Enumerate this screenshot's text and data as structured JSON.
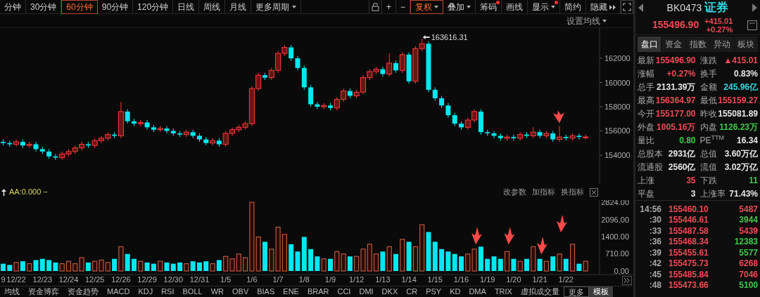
{
  "period_tabs": [
    {
      "label": "分钟",
      "selected": false
    },
    {
      "label": "30分钟",
      "selected": false
    },
    {
      "label": "60分钟",
      "selected": true
    },
    {
      "label": "90分钟",
      "selected": false
    },
    {
      "label": "120分钟",
      "selected": false
    },
    {
      "label": "日线",
      "selected": false
    },
    {
      "label": "周线",
      "selected": false
    },
    {
      "label": "月线",
      "selected": false
    }
  ],
  "more_periods": "更多周期",
  "tools": [
    {
      "kind": "lock"
    },
    {
      "kind": "text",
      "label": "+",
      "caret": false,
      "dot": false,
      "highlighted": false,
      "arrows": false
    },
    {
      "kind": "text",
      "label": "−",
      "caret": false,
      "dot": false,
      "highlighted": false,
      "arrows": false
    },
    {
      "kind": "text",
      "label": "复权",
      "caret": true,
      "dot": false,
      "highlighted": true,
      "arrows": false
    },
    {
      "kind": "text",
      "label": "叠加",
      "caret": true,
      "dot": false,
      "highlighted": false,
      "arrows": false
    },
    {
      "kind": "text",
      "label": "筹码",
      "caret": false,
      "dot": true,
      "highlighted": false,
      "arrows": false
    },
    {
      "kind": "text",
      "label": "画线",
      "caret": false,
      "dot": false,
      "highlighted": false,
      "arrows": false
    },
    {
      "kind": "text",
      "label": "显示",
      "caret": true,
      "dot": true,
      "highlighted": false,
      "arrows": false
    },
    {
      "kind": "text",
      "label": "简约",
      "caret": false,
      "dot": false,
      "highlighted": false,
      "arrows": false
    },
    {
      "kind": "text",
      "label": "隐藏",
      "caret": false,
      "dot": false,
      "highlighted": false,
      "arrows": true
    },
    {
      "kind": "expand"
    }
  ],
  "ma_settings": "设置均线",
  "price_chart": {
    "chart_data": {
      "type": "candlestick",
      "categories": [
        null,
        null,
        null,
        null,
        null,
        null,
        null,
        null,
        null,
        null,
        null,
        null,
        null,
        null,
        null,
        null,
        null,
        null,
        null,
        null,
        null,
        null,
        null,
        null,
        null,
        null,
        null,
        null,
        null,
        null,
        null,
        null,
        null,
        null,
        null,
        null,
        null,
        null,
        null,
        null,
        null,
        null,
        null,
        null,
        null,
        null,
        null,
        null,
        null,
        null,
        null,
        null,
        null,
        null,
        null,
        null,
        null,
        null,
        null,
        null,
        null,
        null,
        null,
        null,
        null,
        null,
        null,
        null,
        null,
        null,
        null,
        null,
        null,
        null,
        null,
        null,
        null,
        null,
        null,
        null,
        null,
        null,
        null,
        null,
        null,
        null,
        null,
        null,
        null,
        null
      ],
      "ylim": [
        151623,
        164493
      ],
      "yticks": [
        {
          "value": 154000,
          "label": "154000"
        },
        {
          "value": 156000,
          "label": "156000"
        },
        {
          "value": 158000,
          "label": "158000"
        },
        {
          "value": 160000,
          "label": "160000"
        },
        {
          "value": 162000,
          "label": "162000"
        }
      ],
      "ohlc": [
        [
          155100,
          155300,
          154800,
          155000
        ],
        [
          155000,
          155200,
          154700,
          154900
        ],
        [
          154900,
          155300,
          154700,
          155100
        ],
        [
          155100,
          155300,
          154600,
          154800
        ],
        [
          154800,
          155100,
          154600,
          154900
        ],
        [
          154900,
          155100,
          154300,
          154500
        ],
        [
          154500,
          154700,
          154100,
          154300
        ],
        [
          154300,
          154500,
          153700,
          153900
        ],
        [
          153900,
          154100,
          153600,
          153800
        ],
        [
          153800,
          154300,
          153600,
          154100
        ],
        [
          154100,
          154500,
          153900,
          154300
        ],
        [
          154300,
          154800,
          154100,
          154600
        ],
        [
          154600,
          155100,
          154400,
          154900
        ],
        [
          154900,
          155100,
          154600,
          154800
        ],
        [
          154800,
          155400,
          154600,
          155200
        ],
        [
          155200,
          155600,
          155000,
          155400
        ],
        [
          155400,
          155900,
          155200,
          155700
        ],
        [
          155700,
          155900,
          155400,
          155600
        ],
        [
          155600,
          158400,
          155400,
          157600
        ],
        [
          157600,
          157800,
          156600,
          156800
        ],
        [
          156800,
          157000,
          156400,
          156600
        ],
        [
          156600,
          156900,
          156400,
          156700
        ],
        [
          156700,
          156900,
          156100,
          156300
        ],
        [
          156300,
          156500,
          155900,
          156100
        ],
        [
          156100,
          156400,
          155900,
          156200
        ],
        [
          156200,
          156400,
          155800,
          156000
        ],
        [
          156000,
          156200,
          155600,
          155800
        ],
        [
          155800,
          156000,
          155500,
          155700
        ],
        [
          155700,
          156100,
          155500,
          155900
        ],
        [
          155900,
          156100,
          155400,
          155600
        ],
        [
          155600,
          155800,
          155100,
          155300
        ],
        [
          155300,
          155500,
          154800,
          155000
        ],
        [
          155000,
          155400,
          154800,
          155200
        ],
        [
          155200,
          155400,
          154700,
          154900
        ],
        [
          154900,
          156000,
          154700,
          155800
        ],
        [
          155800,
          156300,
          155600,
          156100
        ],
        [
          156100,
          156500,
          155900,
          156300
        ],
        [
          156300,
          156800,
          156100,
          156600
        ],
        [
          156600,
          159700,
          156400,
          159500
        ],
        [
          159500,
          160800,
          159300,
          160600
        ],
        [
          160600,
          160800,
          160200,
          160400
        ],
        [
          160400,
          161200,
          160200,
          161000
        ],
        [
          161000,
          162600,
          160800,
          162400
        ],
        [
          162400,
          163100,
          162200,
          162900
        ],
        [
          162900,
          163100,
          161800,
          162000
        ],
        [
          162000,
          162200,
          161000,
          161200
        ],
        [
          161200,
          161400,
          159400,
          159600
        ],
        [
          159600,
          159800,
          158000,
          158200
        ],
        [
          158200,
          158400,
          157800,
          158000
        ],
        [
          158000,
          158300,
          157800,
          158100
        ],
        [
          158100,
          158300,
          157700,
          157900
        ],
        [
          157900,
          158800,
          157700,
          158600
        ],
        [
          158600,
          159500,
          158400,
          159300
        ],
        [
          159300,
          159500,
          158700,
          158900
        ],
        [
          158900,
          159400,
          158700,
          159200
        ],
        [
          159200,
          160600,
          159000,
          160400
        ],
        [
          160400,
          161100,
          160200,
          160900
        ],
        [
          160900,
          161300,
          160700,
          161100
        ],
        [
          161100,
          161300,
          160500,
          160700
        ],
        [
          160700,
          162400,
          160500,
          161600
        ],
        [
          161600,
          161800,
          160800,
          161000
        ],
        [
          161000,
          162500,
          160800,
          162300
        ],
        [
          162300,
          162500,
          159900,
          160100
        ],
        [
          160100,
          163000,
          159900,
          162800
        ],
        [
          162800,
          163616.31,
          162600,
          163200
        ],
        [
          163200,
          163400,
          159200,
          159400
        ],
        [
          159400,
          159600,
          158500,
          158700
        ],
        [
          158700,
          158900,
          157900,
          158100
        ],
        [
          158100,
          158300,
          157100,
          157300
        ],
        [
          157300,
          157500,
          156400,
          156600
        ],
        [
          156600,
          156800,
          156100,
          156300
        ],
        [
          156300,
          157100,
          156100,
          156900
        ],
        [
          156900,
          157800,
          156700,
          157600
        ],
        [
          157600,
          157800,
          155700,
          155900
        ],
        [
          155900,
          156100,
          155600,
          155800
        ],
        [
          155800,
          156000,
          155400,
          155600
        ],
        [
          155600,
          155800,
          155200,
          155400
        ],
        [
          155400,
          155700,
          155200,
          155500
        ],
        [
          155500,
          155700,
          155200,
          155400
        ],
        [
          155400,
          155900,
          155200,
          155700
        ],
        [
          155700,
          155900,
          155400,
          155600
        ],
        [
          155600,
          156300,
          155400,
          155900
        ],
        [
          155900,
          156100,
          155400,
          155600
        ],
        [
          155600,
          156000,
          155400,
          155800
        ],
        [
          155800,
          156000,
          155100,
          155300
        ],
        [
          155300,
          156400,
          155100,
          155500
        ],
        [
          155500,
          155700,
          155200,
          155400
        ],
        [
          155400,
          155800,
          155200,
          155600
        ],
        [
          155600,
          155800,
          155300,
          155500
        ],
        [
          155500,
          155700,
          155300,
          155500
        ]
      ],
      "annotations": [
        {
          "text": "163616.31"
        }
      ]
    }
  },
  "indicator_header": {
    "label": "AA:0.000 −",
    "actions": [
      "改参数",
      "加指标",
      "换指标"
    ]
  },
  "volume_chart": {
    "chart_data": {
      "type": "bar",
      "categories": [
        "9",
        null,
        "12/22",
        null,
        null,
        null,
        "12/23",
        null,
        null,
        null,
        "12/24",
        null,
        null,
        null,
        "12/25",
        null,
        null,
        null,
        "12/26",
        null,
        null,
        null,
        "12/29",
        null,
        null,
        null,
        "12/30",
        null,
        null,
        null,
        "12/31",
        null,
        null,
        null,
        "1/5",
        null,
        null,
        null,
        "1/6",
        null,
        null,
        null,
        "1/7",
        null,
        null,
        null,
        "1/8",
        null,
        null,
        null,
        "1/9",
        null,
        null,
        null,
        "1/12",
        null,
        null,
        null,
        "1/13",
        null,
        null,
        null,
        "1/14",
        null,
        null,
        null,
        "1/15",
        null,
        null,
        null,
        "1/16",
        null,
        null,
        null,
        "1/19",
        null,
        null,
        null,
        "1/20",
        null,
        null,
        null,
        "1/21",
        null,
        null,
        null,
        "1/22",
        null,
        null,
        null
      ],
      "ylim": [
        0,
        2910
      ],
      "values": [
        300,
        250,
        350,
        400,
        300,
        450,
        500,
        450,
        350,
        300,
        400,
        300,
        550,
        350,
        400,
        450,
        350,
        500,
        1000,
        700,
        500,
        400,
        350,
        300,
        400,
        350,
        300,
        350,
        300,
        400,
        350,
        400,
        300,
        450,
        600,
        500,
        700,
        550,
        2824,
        1400,
        1200,
        900,
        1800,
        1500,
        1100,
        800,
        1400,
        900,
        600,
        500,
        500,
        800,
        700,
        600,
        600,
        900,
        1100,
        700,
        800,
        1000,
        700,
        1300,
        1200,
        1000,
        1900,
        1600,
        1200,
        900,
        800,
        700,
        600,
        700,
        900,
        1000,
        500,
        600,
        500,
        800,
        500,
        400,
        500,
        1000,
        500,
        400,
        600,
        700,
        500,
        1100,
        300,
        400
      ],
      "yticks": [
        {
          "value": 0,
          "label": "0.00"
        },
        {
          "value": 710,
          "label": "710.00"
        },
        {
          "value": 1400,
          "label": "1400.00"
        },
        {
          "value": 2096,
          "label": "2096.00"
        },
        {
          "value": 2824,
          "label": "2824.00"
        }
      ]
    }
  },
  "indicator_tabs": [
    {
      "label": "均线",
      "kind": "tab",
      "selected": false
    },
    {
      "label": "资金博弈",
      "kind": "tab",
      "selected": false
    },
    {
      "label": "资金趋势",
      "kind": "tab",
      "selected": false
    },
    {
      "label": "MACD",
      "kind": "tab",
      "selected": false
    },
    {
      "label": "KDJ",
      "kind": "tab",
      "selected": false
    },
    {
      "label": "RSI",
      "kind": "tab",
      "selected": false
    },
    {
      "label": "BOLL",
      "kind": "tab",
      "selected": false
    },
    {
      "label": "WR",
      "kind": "tab",
      "selected": false
    },
    {
      "label": "OBV",
      "kind": "tab",
      "selected": false
    },
    {
      "label": "BIAS",
      "kind": "tab",
      "selected": false
    },
    {
      "label": "ENE",
      "kind": "tab",
      "selected": false
    },
    {
      "label": "BRAR",
      "kind": "tab",
      "selected": false
    },
    {
      "label": "CCI",
      "kind": "tab",
      "selected": false
    },
    {
      "label": "DMI",
      "kind": "tab",
      "selected": false
    },
    {
      "label": "DKX",
      "kind": "tab",
      "selected": false
    },
    {
      "label": "CR",
      "kind": "tab",
      "selected": false
    },
    {
      "label": "PSY",
      "kind": "tab",
      "selected": false
    },
    {
      "label": "KD",
      "kind": "tab",
      "selected": false
    },
    {
      "label": "DMA",
      "kind": "tab",
      "selected": false
    },
    {
      "label": "TRIX",
      "kind": "tab",
      "selected": false
    },
    {
      "label": "虚拟成交量",
      "kind": "tab",
      "selected": false
    },
    {
      "label": "更多",
      "kind": "more",
      "selected": false
    },
    {
      "label": "模板",
      "kind": "tab",
      "selected": true
    }
  ],
  "stock": {
    "code": "BK0473",
    "name": "证券",
    "price": "155496.90",
    "change": "+415.01",
    "change_pct": "+0.27%"
  },
  "panel_tabs": [
    {
      "label": "盘口",
      "selected": true
    },
    {
      "label": "资金",
      "selected": false
    },
    {
      "label": "指数",
      "selected": false
    },
    {
      "label": "异动",
      "selected": false
    },
    {
      "label": "板块",
      "selected": false
    }
  ],
  "quotes": [
    {
      "label": "最新",
      "value": "155496.90",
      "color": "#f04a55"
    },
    {
      "label": "涨跌",
      "value": "▲415.01",
      "color": "#f04a55"
    },
    {
      "label": "涨幅",
      "value": "+0.27%",
      "color": "#f04a55"
    },
    {
      "label": "换手",
      "value": "0.83%",
      "color": "#e6e6e6"
    },
    {
      "label": "总手",
      "value": "2131.39万",
      "color": "#e6e6e6"
    },
    {
      "label": "金额",
      "value": "245.96亿",
      "color": "#2fd6e0"
    },
    {
      "label": "最高",
      "value": "156364.97",
      "color": "#f04a55"
    },
    {
      "label": "最低",
      "value": "155159.27",
      "color": "#f04a55"
    },
    {
      "label": "今开",
      "value": "155177.00",
      "color": "#f04a55"
    },
    {
      "label": "昨收",
      "value": "155081.89",
      "color": "#e6e6e6"
    },
    {
      "label": "外盘",
      "value": "1005.16万",
      "color": "#f04a55"
    },
    {
      "label": "内盘",
      "value": "1126.23万",
      "color": "#3fc84a"
    },
    {
      "label": "量比",
      "value": "0.80",
      "color": "#3fc84a"
    },
    {
      "label": "PE$^{TTM}$",
      "value": "16.34",
      "color": "#e6e6e6"
    },
    {
      "label": "总股本",
      "value": "2931亿",
      "color": "#e6e6e6"
    },
    {
      "label": "总值",
      "value": "3.60万亿",
      "color": "#e6e6e6"
    },
    {
      "label": "流通股",
      "value": "2560亿",
      "color": "#e6e6e6"
    },
    {
      "label": "流值",
      "value": "3.02万亿",
      "color": "#e6e6e6"
    },
    {
      "label": "上涨",
      "value": "35",
      "color": "#f04a55"
    },
    {
      "label": "下跌",
      "value": "11",
      "color": "#3fc84a"
    },
    {
      "label": "平盘",
      "value": "3",
      "color": "#e6e6e6"
    },
    {
      "label": "上涨率",
      "value": "71.43%",
      "color": "#e6e6e6"
    }
  ],
  "trades": [
    {
      "time": "14:56",
      "price": "155460.10",
      "volume": "5487",
      "color": "#f04a55"
    },
    {
      "time": ":30",
      "price": "155446.61",
      "volume": "3944",
      "color": "#3fc84a"
    },
    {
      "time": ":33",
      "price": "155487.58",
      "volume": "5439",
      "color": "#f04a55"
    },
    {
      "time": ":36",
      "price": "155468.34",
      "volume": "12383",
      "color": "#3fc84a"
    },
    {
      "time": ":39",
      "price": "155455.61",
      "volume": "5577",
      "color": "#3fc84a"
    },
    {
      "time": ":42",
      "price": "155475.73",
      "volume": "6268",
      "color": "#f04a55"
    },
    {
      "time": ":45",
      "price": "155485.84",
      "volume": "7046",
      "color": "#f04a55"
    },
    {
      "time": ":48",
      "price": "155473.66",
      "volume": "5100",
      "color": "#3fc84a"
    }
  ]
}
